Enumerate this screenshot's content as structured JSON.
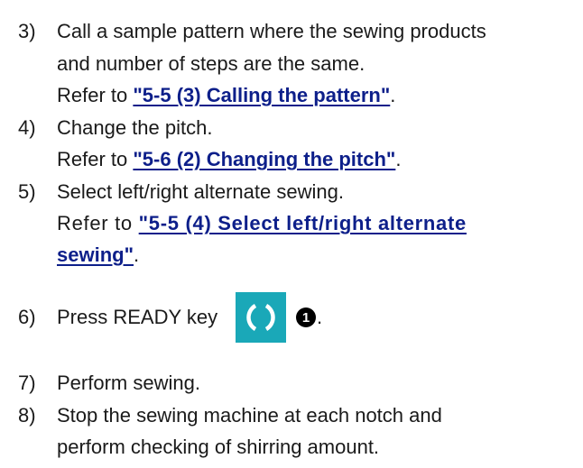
{
  "steps": [
    {
      "num": "3)",
      "lines": [
        "Call a sample pattern where the sewing products",
        "and number of steps are the same."
      ],
      "ref_prefix": "Refer to ",
      "ref_link": "\"5-5 (3) Calling the pattern\"",
      "ref_suffix": "."
    },
    {
      "num": "4)",
      "lines": [
        "Change the pitch."
      ],
      "ref_prefix": "Refer to ",
      "ref_link": "\"5-6 (2) Changing the pitch\"",
      "ref_suffix": "."
    },
    {
      "num": "5)",
      "lines": [
        "Select left/right alternate sewing."
      ],
      "ref_prefix": "Refer to ",
      "ref_link_line1": "\"5-5 (4) Select left/right alternate",
      "ref_link_line2": "sewing\"",
      "ref_suffix": "."
    },
    {
      "num": "6)",
      "text": "Press READY key",
      "callout": "1",
      "suffix": "."
    },
    {
      "num": "7)",
      "lines": [
        "Perform sewing."
      ]
    },
    {
      "num": "8)",
      "lines": [
        "Stop the sewing machine at each notch and",
        "perform checking of shirring amount."
      ]
    }
  ],
  "icons": {
    "ready_key": "ready-key-icon",
    "ready_key_color": "#1aa8b8"
  }
}
